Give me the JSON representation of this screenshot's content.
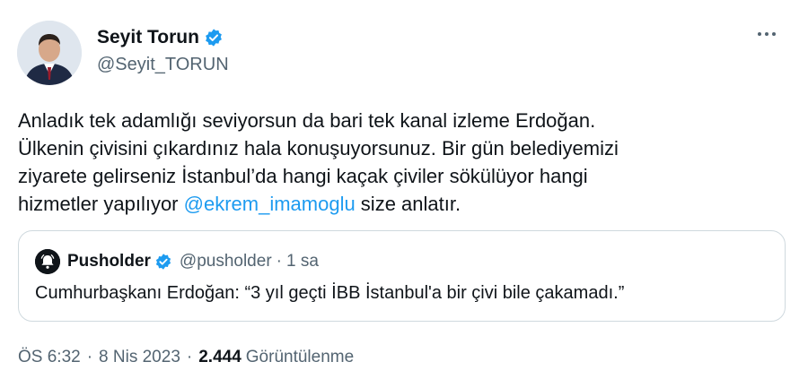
{
  "tweet": {
    "author": {
      "display_name": "Seyit Torun",
      "handle": "@Seyit_TORUN",
      "verified": true
    },
    "text_before_mention": "Anladık tek adamlığı seviyorsun da bari tek kanal izleme Erdoğan.\nÜlkenin çivisini çıkardınız hala konuşuyorsunuz. Bir gün belediyemizi\nziyarete gelirseniz İstanbul’da hangi kaçak çiviler sökülüyor hangi\nhizmetler yapılıyor ",
    "mention": "@ekrem_imamoglu",
    "text_after_mention": " size anlatır.",
    "quote": {
      "display_name": "Pusholder",
      "handle": "@pusholder",
      "separator": "·",
      "time": "1 sa",
      "text": "Cumhurbaşkanı Erdoğan: “3 yıl geçti İBB İstanbul'a bir çivi bile çakamadı.”"
    },
    "meta": {
      "time": "ÖS 6:32",
      "separator": "·",
      "date": "8 Nis 2023",
      "views_count": "2.444",
      "views_label": "Görüntülenme"
    }
  },
  "icons": {
    "verified": "verified-badge-icon",
    "more": "more-options-icon",
    "quote_avatar": "pusholder-logo-icon"
  },
  "colors": {
    "accent": "#1d9bf0",
    "text": "#0f1419",
    "secondary": "#536471",
    "border": "#cfd9de"
  }
}
